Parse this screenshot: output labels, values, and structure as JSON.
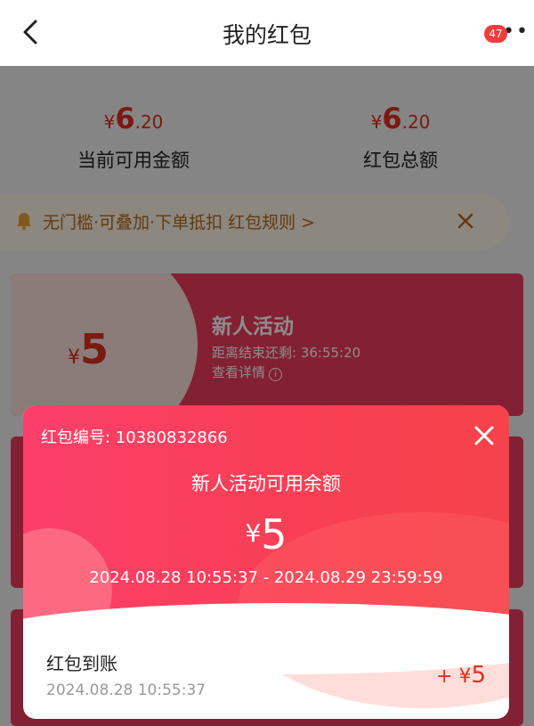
{
  "header": {
    "title": "我的红包",
    "badge": "47"
  },
  "summary": {
    "available": {
      "currency": "¥",
      "integer": "6",
      "decimal": ".20",
      "label": "当前可用金额"
    },
    "total": {
      "currency": "¥",
      "integer": "6",
      "decimal": ".20",
      "label": "红包总额"
    }
  },
  "notice": {
    "text": "无门槛·可叠加·下单抵扣 红包规则 >"
  },
  "card": {
    "currency": "¥",
    "value": "5",
    "name": "新人活动",
    "countdown": "距离结束还剩: 36:55:20",
    "detail": "查看详情"
  },
  "modal": {
    "red_packet_id": "红包编号: 10380832866",
    "title": "新人活动可用余额",
    "currency": "¥",
    "amount": "5",
    "period": "2024.08.28 10:55:37 - 2024.08.29 23:59:59",
    "record": {
      "label": "红包到账",
      "time": "2024.08.28 10:55:37",
      "amount_prefix": "+ ¥",
      "amount": "5"
    }
  },
  "colors": {
    "accent_red": "#e0301e",
    "card_red": "#f03b5d",
    "notice_bg": "#fff6e8",
    "notice_text": "#b46a1e"
  }
}
